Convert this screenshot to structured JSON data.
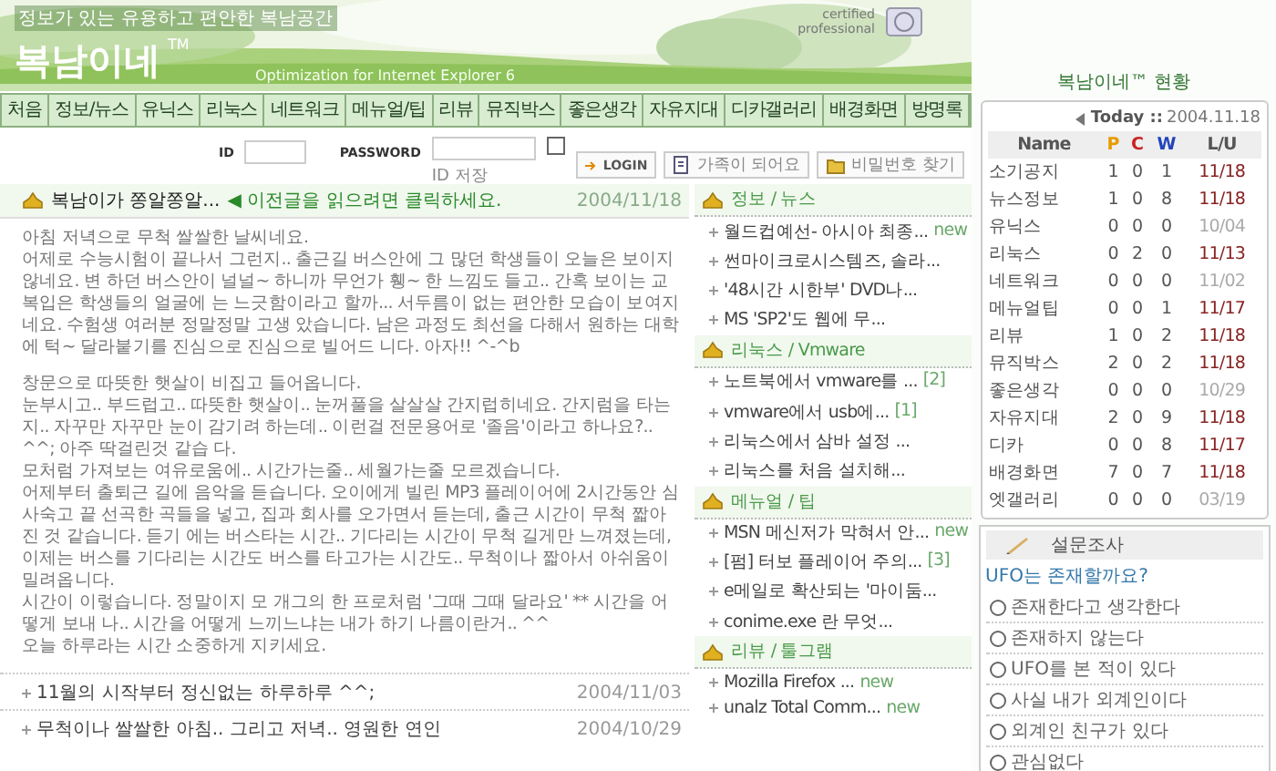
{
  "header": {
    "tagline": "정보가 있는 유용하고 편안한 복남공간",
    "logo": "복남이네",
    "logo_mark": "TM",
    "subtitle": "Optimization for Internet Explorer 6",
    "badge": "certified professional"
  },
  "nav": [
    {
      "label": "처음"
    },
    {
      "label": "정보/뉴스"
    },
    {
      "label": "유닉스"
    },
    {
      "label": "리눅스"
    },
    {
      "label": "네트워크"
    },
    {
      "label": "메뉴얼/팁"
    },
    {
      "label": "리뷰"
    },
    {
      "label": "뮤직박스"
    },
    {
      "label": "좋은생각"
    },
    {
      "label": "자유지대"
    },
    {
      "label": "디카갤러리"
    },
    {
      "label": "배경화면"
    },
    {
      "label": "방명록"
    }
  ],
  "login": {
    "id_label": "ID",
    "password_label": "PASSWORD",
    "remember": {
      "label": "ID 저장",
      "checked": false
    },
    "buttons": [
      {
        "label": "LOGIN",
        "kind": "login"
      },
      {
        "label": "가족이 되어요",
        "kind": "join"
      },
      {
        "label": "비밀번호 찾기",
        "kind": "find"
      }
    ]
  },
  "notice": {
    "title": "복남이가 쫑알쫑알...",
    "link": "◀ 이전글을 읽으려면 클릭하세요.",
    "date": "2004/11/18"
  },
  "post": {
    "sections": [
      [
        "아침 저녁으로 무척 쌀쌀한 날씨네요.",
        "어제로 수능시험이 끝나서 그런지.. 출근길 버스안에 그 많던 학생들이 오늘은 보이지 않네요. 변 하던 버스안이 널널~ 하니까 무언가 휑~ 한 느낌도 들고.. 간혹 보이는 교복입은 학생들의 얼굴에 는 느긋함이라고 할까... 서두름이 없는 편안한 모습이 보여지네요. 수험생 여러분 정말정말 고생 았습니다. 남은 과정도 최선을 다해서 원하는 대학에 턱~ 달라붙기를 진심으로 진심으로 빌어드 니다. 아자!! ^-^b"
      ],
      [
        "창문으로 따뜻한 햇살이 비집고 들어옵니다.",
        "눈부시고.. 부드럽고.. 따뜻한 햇살이.. 눈꺼풀을 살살살 간지럽히네요. 간지럼을 타는지.. 자꾸만 자꾸만 눈이 감기려 하는데.. 이런걸 전문용어로 '졸음'이라고 하나요?.. ^^; 아주 딱걸린것 같습 다.",
        "모처럼 가져보는 여유로움에.. 시간가는줄.. 세월가는줄 모르겠습니다.",
        "어제부터 출퇴근 길에 음악을 듣습니다. 오이에게 빌린 MP3 플레이어에 2시간동안 심사숙고 끝 선곡한 곡들을 넣고, 집과 회사를 오가면서 듣는데, 출근 시간이 무척 짧아진 것 같습니다. 듣기 에는 버스타는 시간.. 기다리는 시간이 무척 길게만 느껴졌는데, 이제는 버스를 기다리는 시간도 버스를 타고가는 시간도.. 무척이나 짧아서 아쉬움이 밀려옵니다.",
        "시간이 이렇습니다. 정말이지 모 개그의 한 프로처럼 '그때 그때 달라요' ** 시간을 어떻게 보내 나.. 시간을 어떻게 느끼느냐는 내가 하기 나름이란거.. ^^",
        "오늘 하루라는 시간 소중하게 지키세요."
      ]
    ]
  },
  "recent_posts": [
    {
      "title": "11월의 시작부터 정신없는 하루하루 ^^;",
      "date": "2004/11/03"
    },
    {
      "title": "무척이나 쌀쌀한 아침.. 그리고 저녁.. 영원한 연인",
      "date": "2004/10/29"
    }
  ],
  "boards": [
    {
      "title": "정보 / 뉴스",
      "items": [
        {
          "text": "월드컵예선- 아시아 최종...",
          "extra": "new"
        },
        {
          "text": "썬마이크로시스템즈, 솔라..."
        },
        {
          "text": "'48시간 시한부' DVD나..."
        },
        {
          "text": "MS 'SP2'도 웹에 무..."
        }
      ]
    },
    {
      "title": "리눅스 / Vmware",
      "items": [
        {
          "text": "노트북에서 vmware를 ...",
          "extra": "[2]"
        },
        {
          "text": "vmware에서 usb에...",
          "extra": "[1]"
        },
        {
          "text": "리눅스에서 삼바 설정 ..."
        },
        {
          "text": "리눅스를 처음 설치해..."
        }
      ]
    },
    {
      "title": "메뉴얼 / 팁",
      "items": [
        {
          "text": "MSN 메신저가 막혀서 안...",
          "extra": "new"
        },
        {
          "text": "[펌] 터보 플레이어 주의...",
          "extra": "[3]"
        },
        {
          "text": "e메일로 확산되는 '마이둠..."
        },
        {
          "text": "conime.exe 란 무엇..."
        }
      ]
    },
    {
      "title": "리뷰 / 툴그램",
      "items": [
        {
          "text": "Mozilla Firefox ...",
          "extra": "new"
        },
        {
          "text": "unalz Total Comm...",
          "extra": "new"
        }
      ]
    }
  ],
  "stats": {
    "title": "복남이네™ 현황",
    "today": "Today ::",
    "date": "2004.11.18",
    "columns": [
      {
        "label": "Name",
        "color": "#555555"
      },
      {
        "label": "P",
        "color": "#e89a00"
      },
      {
        "label": "C",
        "color": "#cc2222"
      },
      {
        "label": "W",
        "color": "#2244bb"
      },
      {
        "label": "L/U",
        "color": "#555555"
      }
    ],
    "rows": [
      {
        "name": "소기공지",
        "p": "1",
        "c": "0",
        "w": "1",
        "updated": "11/18",
        "recent": true
      },
      {
        "name": "뉴스정보",
        "p": "1",
        "c": "0",
        "w": "8",
        "updated": "11/18",
        "recent": true
      },
      {
        "name": "유닉스",
        "p": "0",
        "c": "0",
        "w": "0",
        "updated": "10/04",
        "recent": false
      },
      {
        "name": "리눅스",
        "p": "0",
        "c": "2",
        "w": "0",
        "updated": "11/13",
        "recent": true
      },
      {
        "name": "네트워크",
        "p": "0",
        "c": "0",
        "w": "0",
        "updated": "11/02",
        "recent": false
      },
      {
        "name": "메뉴얼팁",
        "p": "0",
        "c": "0",
        "w": "1",
        "updated": "11/17",
        "recent": true
      },
      {
        "name": "리뷰",
        "p": "1",
        "c": "0",
        "w": "2",
        "updated": "11/18",
        "recent": true
      },
      {
        "name": "뮤직박스",
        "p": "2",
        "c": "0",
        "w": "2",
        "updated": "11/18",
        "recent": true
      },
      {
        "name": "좋은생각",
        "p": "0",
        "c": "0",
        "w": "0",
        "updated": "10/29",
        "recent": false
      },
      {
        "name": "자유지대",
        "p": "2",
        "c": "0",
        "w": "9",
        "updated": "11/18",
        "recent": true
      },
      {
        "name": "디카",
        "p": "0",
        "c": "0",
        "w": "8",
        "updated": "11/17",
        "recent": true
      },
      {
        "name": "배경화면",
        "p": "7",
        "c": "0",
        "w": "7",
        "updated": "11/18",
        "recent": true
      },
      {
        "name": "엣갤러리",
        "p": "0",
        "c": "0",
        "w": "0",
        "updated": "03/19",
        "recent": false
      }
    ]
  },
  "poll": {
    "title": "설문조사",
    "question": "UFO는 존재할까요?",
    "options": [
      {
        "label": "존재한다고 생각한다",
        "selected": false
      },
      {
        "label": "존재하지 않는다",
        "selected": false
      },
      {
        "label": "UFO를 본 적이 있다",
        "selected": false
      },
      {
        "label": "사실 내가 외계인이다",
        "selected": false
      },
      {
        "label": "외계인 친구가 있다",
        "selected": false
      },
      {
        "label": "관심없다",
        "selected": false
      }
    ]
  }
}
